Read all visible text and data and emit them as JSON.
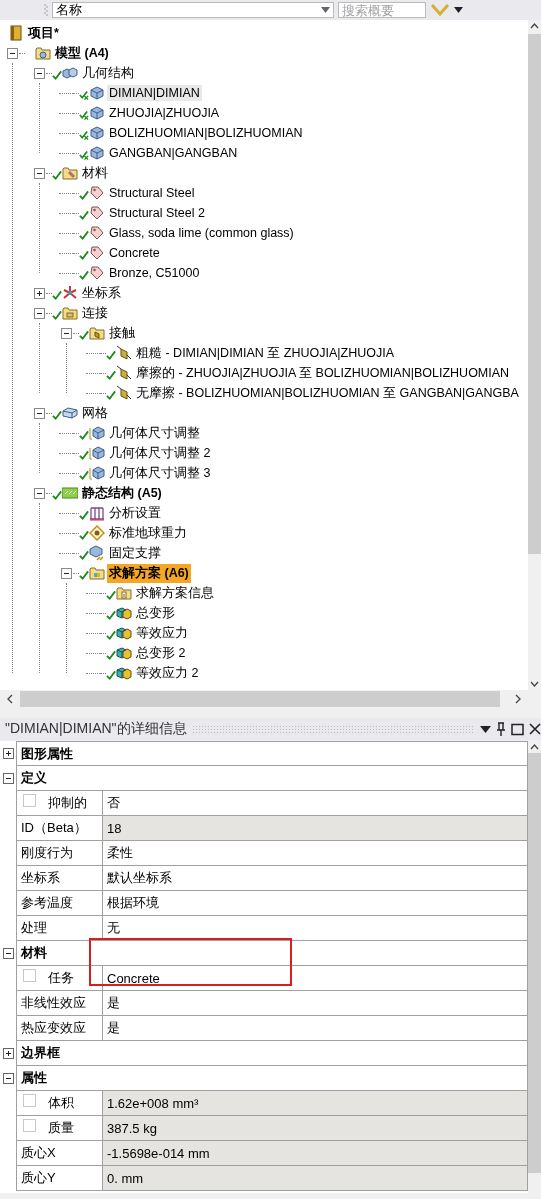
{
  "toolbar": {
    "sort_field": "名称",
    "search": {
      "placeholder": "搜索概要"
    }
  },
  "tree": {
    "label": "项目*",
    "kind": "project",
    "bold": true,
    "selected": false,
    "children": [
      {
        "label": "模型 (A4)",
        "kind": "model",
        "bold": true,
        "selected": false,
        "expanded": true,
        "children": [
          {
            "label": "几何结构",
            "kind": "geometry",
            "bold": false,
            "selected": false,
            "expanded": true,
            "children": [
              {
                "label": "DIMIAN|DIMIAN",
                "kind": "body",
                "bold": false,
                "selected": true
              },
              {
                "label": "ZHUOJIA|ZHUOJIA",
                "kind": "body",
                "bold": false,
                "selected": false
              },
              {
                "label": "BOLIZHUOMIAN|BOLIZHUOMIAN",
                "kind": "body",
                "bold": false,
                "selected": false
              },
              {
                "label": "GANGBAN|GANGBAN",
                "kind": "body",
                "bold": false,
                "selected": false
              }
            ]
          },
          {
            "label": "材料",
            "kind": "materials",
            "bold": false,
            "selected": false,
            "expanded": true,
            "children": [
              {
                "label": "Structural Steel",
                "kind": "material",
                "bold": false,
                "selected": false
              },
              {
                "label": "Structural Steel 2",
                "kind": "material",
                "bold": false,
                "selected": false
              },
              {
                "label": "Glass, soda lime (common glass)",
                "kind": "material",
                "bold": false,
                "selected": false
              },
              {
                "label": "Concrete",
                "kind": "material",
                "bold": false,
                "selected": false
              },
              {
                "label": "Bronze, C51000",
                "kind": "material",
                "bold": false,
                "selected": false
              }
            ]
          },
          {
            "label": "坐标系",
            "kind": "coords",
            "bold": false,
            "selected": false,
            "expanded": false
          },
          {
            "label": "连接",
            "kind": "connections",
            "bold": false,
            "selected": false,
            "expanded": true,
            "children": [
              {
                "label": "接触",
                "kind": "contacts",
                "bold": false,
                "selected": false,
                "expanded": true,
                "children": [
                  {
                    "label": "粗糙 - DIMIAN|DIMIAN 至 ZHUOJIA|ZHUOJIA",
                    "kind": "contact",
                    "bold": false,
                    "selected": false
                  },
                  {
                    "label": "摩擦的 - ZHUOJIA|ZHUOJIA 至 BOLIZHUOMIAN|BOLIZHUOMIAN",
                    "kind": "contact",
                    "bold": false,
                    "selected": false
                  },
                  {
                    "label": "无摩擦 - BOLIZHUOMIAN|BOLIZHUOMIAN 至 GANGBAN|GANGBA",
                    "kind": "contact",
                    "bold": false,
                    "selected": false
                  }
                ]
              }
            ]
          },
          {
            "label": "网格",
            "kind": "mesh",
            "bold": false,
            "selected": false,
            "expanded": true,
            "children": [
              {
                "label": "几何体尺寸调整",
                "kind": "sizing",
                "bold": false,
                "selected": false
              },
              {
                "label": "几何体尺寸调整 2",
                "kind": "sizing",
                "bold": false,
                "selected": false
              },
              {
                "label": "几何体尺寸调整 3",
                "kind": "sizing",
                "bold": false,
                "selected": false
              }
            ]
          },
          {
            "label": "静态结构 (A5)",
            "kind": "analysis",
            "bold": true,
            "selected": false,
            "expanded": true,
            "children": [
              {
                "label": "分析设置",
                "kind": "settings",
                "bold": false,
                "selected": false
              },
              {
                "label": "标准地球重力",
                "kind": "gravity",
                "bold": false,
                "selected": false
              },
              {
                "label": "固定支撑",
                "kind": "support",
                "bold": false,
                "selected": false
              },
              {
                "label": "求解方案 (A6)",
                "kind": "solution",
                "bold": true,
                "selected": false,
                "highlighted": true,
                "expanded": true,
                "children": [
                  {
                    "label": "求解方案信息",
                    "kind": "info",
                    "bold": false,
                    "selected": false
                  },
                  {
                    "label": "总变形",
                    "kind": "result",
                    "bold": false,
                    "selected": false
                  },
                  {
                    "label": "等效应力",
                    "kind": "result",
                    "bold": false,
                    "selected": false
                  },
                  {
                    "label": "总变形 2",
                    "kind": "result",
                    "bold": false,
                    "selected": false
                  },
                  {
                    "label": "等效应力 2",
                    "kind": "result",
                    "bold": false,
                    "selected": false
                  }
                ]
              }
            ]
          }
        ]
      }
    ]
  },
  "details": {
    "title": "\"DIMIAN|DIMIAN\"的详细信息",
    "categories": [
      {
        "label": "图形属性",
        "expanded": false
      },
      {
        "label": "定义",
        "expanded": true,
        "properties": [
          {
            "label": "抑制的",
            "value": "否",
            "kind": "check",
            "checked": false,
            "readonly": false,
            "annotated": false
          },
          {
            "label": "ID（Beta）",
            "value": "18",
            "kind": "plain",
            "readonly": true,
            "annotated": false
          },
          {
            "label": "刚度行为",
            "value": "柔性",
            "kind": "plain",
            "readonly": false,
            "annotated": false
          },
          {
            "label": "坐标系",
            "value": "默认坐标系",
            "kind": "plain",
            "readonly": false,
            "annotated": false
          },
          {
            "label": "参考温度",
            "value": "根据环境",
            "kind": "plain",
            "readonly": false,
            "annotated": false
          },
          {
            "label": "处理",
            "value": "无",
            "kind": "plain",
            "readonly": false,
            "annotated": false
          }
        ]
      },
      {
        "label": "材料",
        "expanded": true,
        "properties": [
          {
            "label": "任务",
            "value": "Concrete",
            "kind": "check",
            "checked": false,
            "readonly": false,
            "annotated": true
          },
          {
            "label": "非线性效应",
            "value": "是",
            "kind": "plain",
            "readonly": false,
            "annotated": false
          },
          {
            "label": "热应变效应",
            "value": "是",
            "kind": "plain",
            "readonly": false,
            "annotated": false
          }
        ]
      },
      {
        "label": "边界框",
        "expanded": false
      },
      {
        "label": "属性",
        "expanded": true,
        "properties": [
          {
            "label": "体积",
            "value": "1.62e+008 mm³",
            "kind": "check",
            "checked": false,
            "readonly": true,
            "annotated": false
          },
          {
            "label": "质量",
            "value": "387.5 kg",
            "kind": "check",
            "checked": false,
            "readonly": true,
            "annotated": false
          },
          {
            "label": "质心X",
            "value": "-1.5698e-014 mm",
            "kind": "plain",
            "readonly": true,
            "annotated": false
          },
          {
            "label": "质心Y",
            "value": "0. mm",
            "kind": "plain",
            "readonly": true,
            "annotated": false
          }
        ]
      }
    ]
  }
}
